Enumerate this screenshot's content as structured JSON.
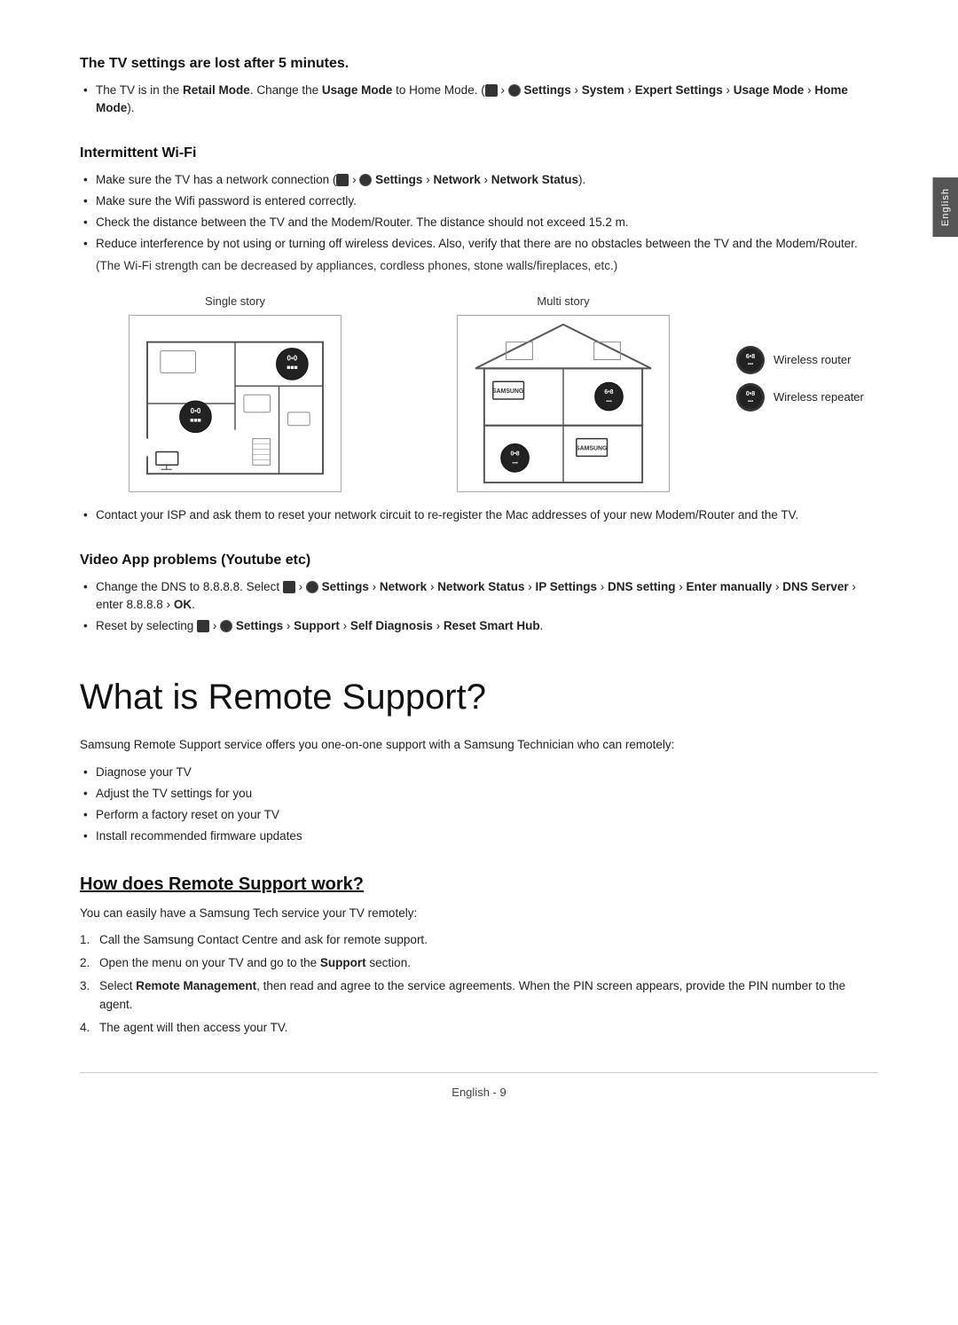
{
  "side_tab": {
    "text": "English"
  },
  "section1": {
    "title": "The TV settings are lost after 5 minutes.",
    "bullets": [
      {
        "text": "The TV is in the ",
        "bold1": "Retail Mode",
        "mid1": ". Change the ",
        "bold2": "Usage Mode",
        "mid2": " to Home Mode. (",
        "icon_home": true,
        "icon_gear": true,
        "rest": " Settings › System › Expert Settings › Usage Mode › Home Mode)."
      }
    ]
  },
  "section2": {
    "title": "Intermittent Wi-Fi",
    "bullets": [
      "Make sure the TV has a network connection (⌂ › ⚙ Settings › Network › Network Status).",
      "Make sure the Wifi password is entered correctly.",
      "Check the distance between the TV and the Modem/Router. The distance should not exceed 15.2 m.",
      "Reduce interference by not using or turning off wireless devices. Also, verify that there are no obstacles between the TV and the Modem/Router."
    ],
    "indent": "(The Wi-Fi strength can be decreased by appliances, cordless phones, stone walls/fireplaces, etc.)",
    "diagram": {
      "left_label": "Single story",
      "right_label": "Multi story"
    },
    "legend": {
      "items": [
        {
          "label": "Wireless router"
        },
        {
          "label": "Wireless repeater"
        }
      ]
    },
    "contact_bullet": "Contact your ISP and ask them to reset your network circuit to re-register the Mac addresses of your new Modem/Router and the TV."
  },
  "section3": {
    "title": "Video App problems (Youtube etc)",
    "bullets": [
      {
        "text": "Change the DNS to 8.8.8.8. Select ⌂ › ⚙ Settings › Network › Network Status › IP Settings › DNS setting › Enter manually › DNS Server › enter 8.8.8.8 › OK."
      },
      {
        "text": "Reset by selecting ⌂ › ⚙ Settings › Support › Self Diagnosis › Reset Smart Hub."
      }
    ]
  },
  "section4": {
    "title": "What is Remote Support?",
    "intro": "Samsung Remote Support service offers you one-on-one support with a Samsung Technician who can remotely:",
    "bullets": [
      "Diagnose your TV",
      "Adjust the TV settings for you",
      "Perform a factory reset on your TV",
      "Install recommended firmware updates"
    ]
  },
  "section5": {
    "title": "How does Remote Support work?",
    "intro": "You can easily have a Samsung Tech service your TV remotely:",
    "steps": [
      "Call the Samsung Contact Centre and ask for remote support.",
      "Open the menu on your TV and go to the Support section.",
      "Select Remote Management, then read and agree to the service agreements. When the PIN screen appears, provide the PIN number to the agent.",
      "The agent will then access your TV."
    ]
  },
  "footer": {
    "text": "English - 9"
  }
}
